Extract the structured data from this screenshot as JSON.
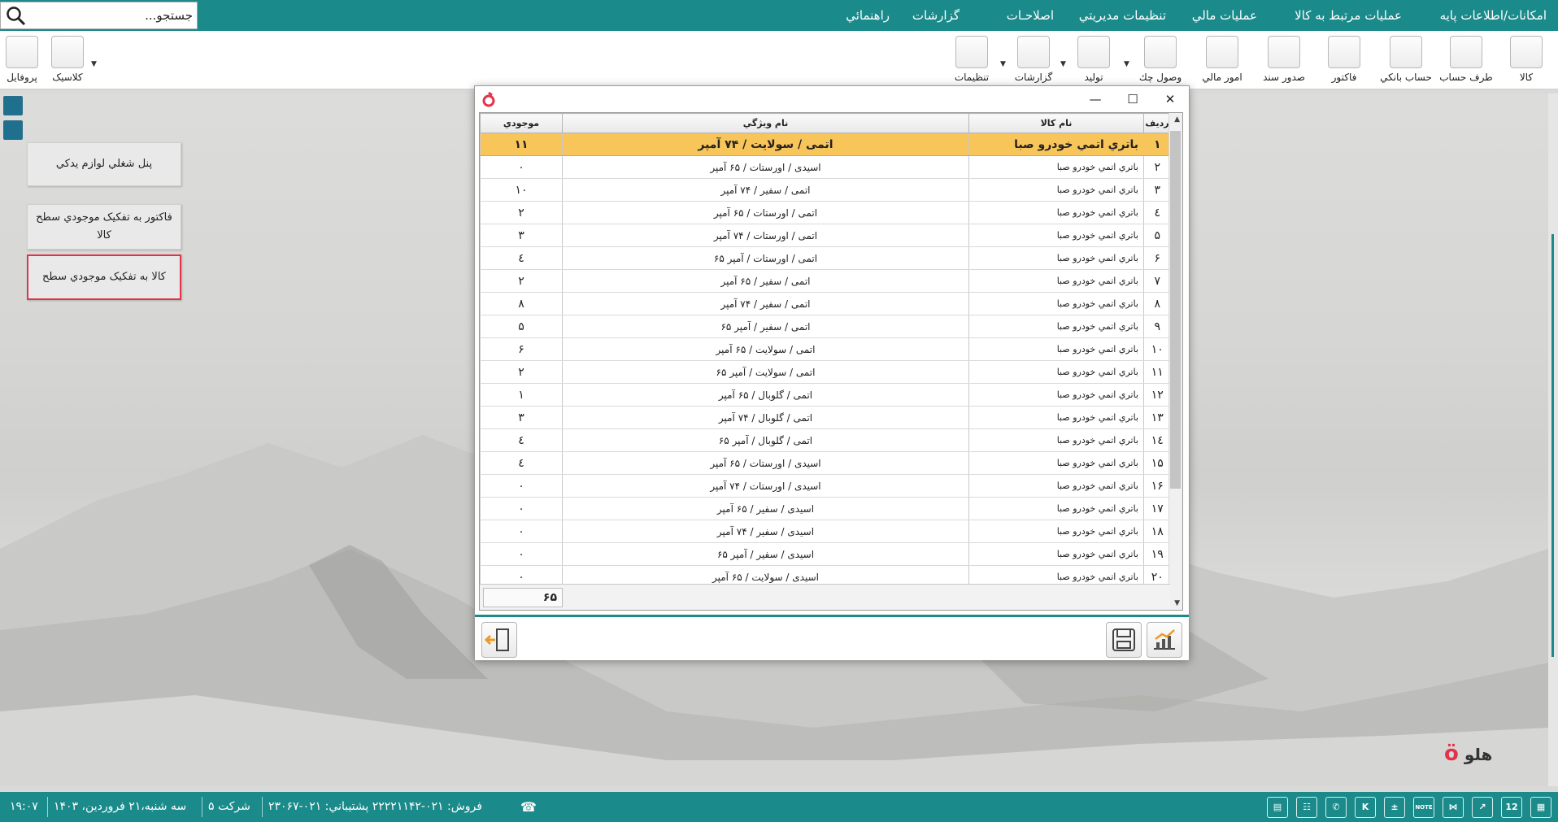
{
  "menu": {
    "items": [
      "امکانات/اطلاعات پايه",
      "عمليات مرتبط به کالا",
      "عمليات مالي",
      "تنظيمات مديريتي",
      "اصلاحـات",
      "گزارشات",
      "راهنمائي"
    ],
    "search_placeholder": "جستجو..."
  },
  "toolbar": {
    "items": [
      "کالا",
      "طرف حساب",
      "حساب بانکي",
      "فاکتور",
      "صدور سند",
      "امور مالي",
      "وصول چك",
      "توليد",
      "گزارشات",
      "تنظيمات"
    ],
    "left_items": [
      "کلاسيک",
      "پروفايل"
    ]
  },
  "panel": {
    "buttons": [
      "پنل شغلي لوازم يدکي",
      "فاکتور به تفکيک موجودي سطح کالا",
      "کالا به تفکيک موجودي سطح"
    ]
  },
  "dialog": {
    "columns": {
      "row": "رديف",
      "name": "نام کالا",
      "prop": "نام ويژگي",
      "qty": "موجودي"
    },
    "rows": [
      [
        "۱",
        "باتري اتمي خودرو صبا",
        "اتمی / سولایت / ۷۴ آمپر",
        "۱۱"
      ],
      [
        "۲",
        "باتري اتمي خودرو صبا",
        "اسیدی / اورستات / ۶۵ آمپر",
        "۰"
      ],
      [
        "۳",
        "باتري اتمي خودرو صبا",
        "اتمی / سفیر / ۷۴ آمپر",
        "۱۰"
      ],
      [
        "٤",
        "باتري اتمي خودرو صبا",
        "اتمی / اورستات / ۶۵ آمپر",
        "۲"
      ],
      [
        "۵",
        "باتري اتمي خودرو صبا",
        "اتمی / اورستات / ۷۴ آمپر",
        "۳"
      ],
      [
        "۶",
        "باتري اتمي خودرو صبا",
        "اتمی / اورستات / آمپر ۶۵",
        "٤"
      ],
      [
        "۷",
        "باتري اتمي خودرو صبا",
        "اتمی / سفیر / ۶۵ آمپر",
        "۲"
      ],
      [
        "۸",
        "باتري اتمي خودرو صبا",
        "اتمی / سفیر / ۷۴ آمپر",
        "۸"
      ],
      [
        "۹",
        "باتري اتمي خودرو صبا",
        "اتمی / سفیر / آمپر ۶۵",
        "۵"
      ],
      [
        "۱۰",
        "باتري اتمي خودرو صبا",
        "اتمی / سولایت / ۶۵ آمپر",
        "۶"
      ],
      [
        "۱۱",
        "باتري اتمي خودرو صبا",
        "اتمی / سولایت / آمپر ۶۵",
        "۲"
      ],
      [
        "۱۲",
        "باتري اتمي خودرو صبا",
        "اتمی / گلوبال / ۶۵ آمپر",
        "۱"
      ],
      [
        "۱۳",
        "باتري اتمي خودرو صبا",
        "اتمی / گلوبال / ۷۴ آمپر",
        "۳"
      ],
      [
        "۱٤",
        "باتري اتمي خودرو صبا",
        "اتمی / گلوبال / آمپر ۶۵",
        "٤"
      ],
      [
        "۱۵",
        "باتري اتمي خودرو صبا",
        "اسیدی / اورستات / ۶۵ آمپر",
        "٤"
      ],
      [
        "۱۶",
        "باتري اتمي خودرو صبا",
        "اسیدی / اورستات / ۷۴ آمپر",
        "۰"
      ],
      [
        "۱۷",
        "باتري اتمي خودرو صبا",
        "اسیدی / سفیر / ۶۵ آمپر",
        "۰"
      ],
      [
        "۱۸",
        "باتري اتمي خودرو صبا",
        "اسیدی / سفیر / ۷۴ آمپر",
        "۰"
      ],
      [
        "۱۹",
        "باتري اتمي خودرو صبا",
        "اسیدی / سفیر / آمپر ۶۵",
        "۰"
      ],
      [
        "۲۰",
        "باتري اتمي خودرو صبا",
        "اسیدی / سولایت / ۶۵ آمپر",
        "۰"
      ]
    ],
    "selected_row": 0,
    "total": "۶۵"
  },
  "status": {
    "time": "۱۹:۰۷",
    "date": "سه شنبه،۲۱ فروردين، ۱۴۰۳",
    "company": "شرکت ۵",
    "contact": "فروش: ۰۲۱-۲۲۲۲۱۱۴۲  پشتيباني: ۰۲۱-۲۳۰۶۷",
    "calendar_day": "12",
    "k_label": "K",
    "note_label": "NOTE"
  },
  "brand": "هلو",
  "colors": {
    "teal": "#1a8a8a",
    "selected_row": "#f7c55a",
    "active_border": "#e3334a"
  }
}
